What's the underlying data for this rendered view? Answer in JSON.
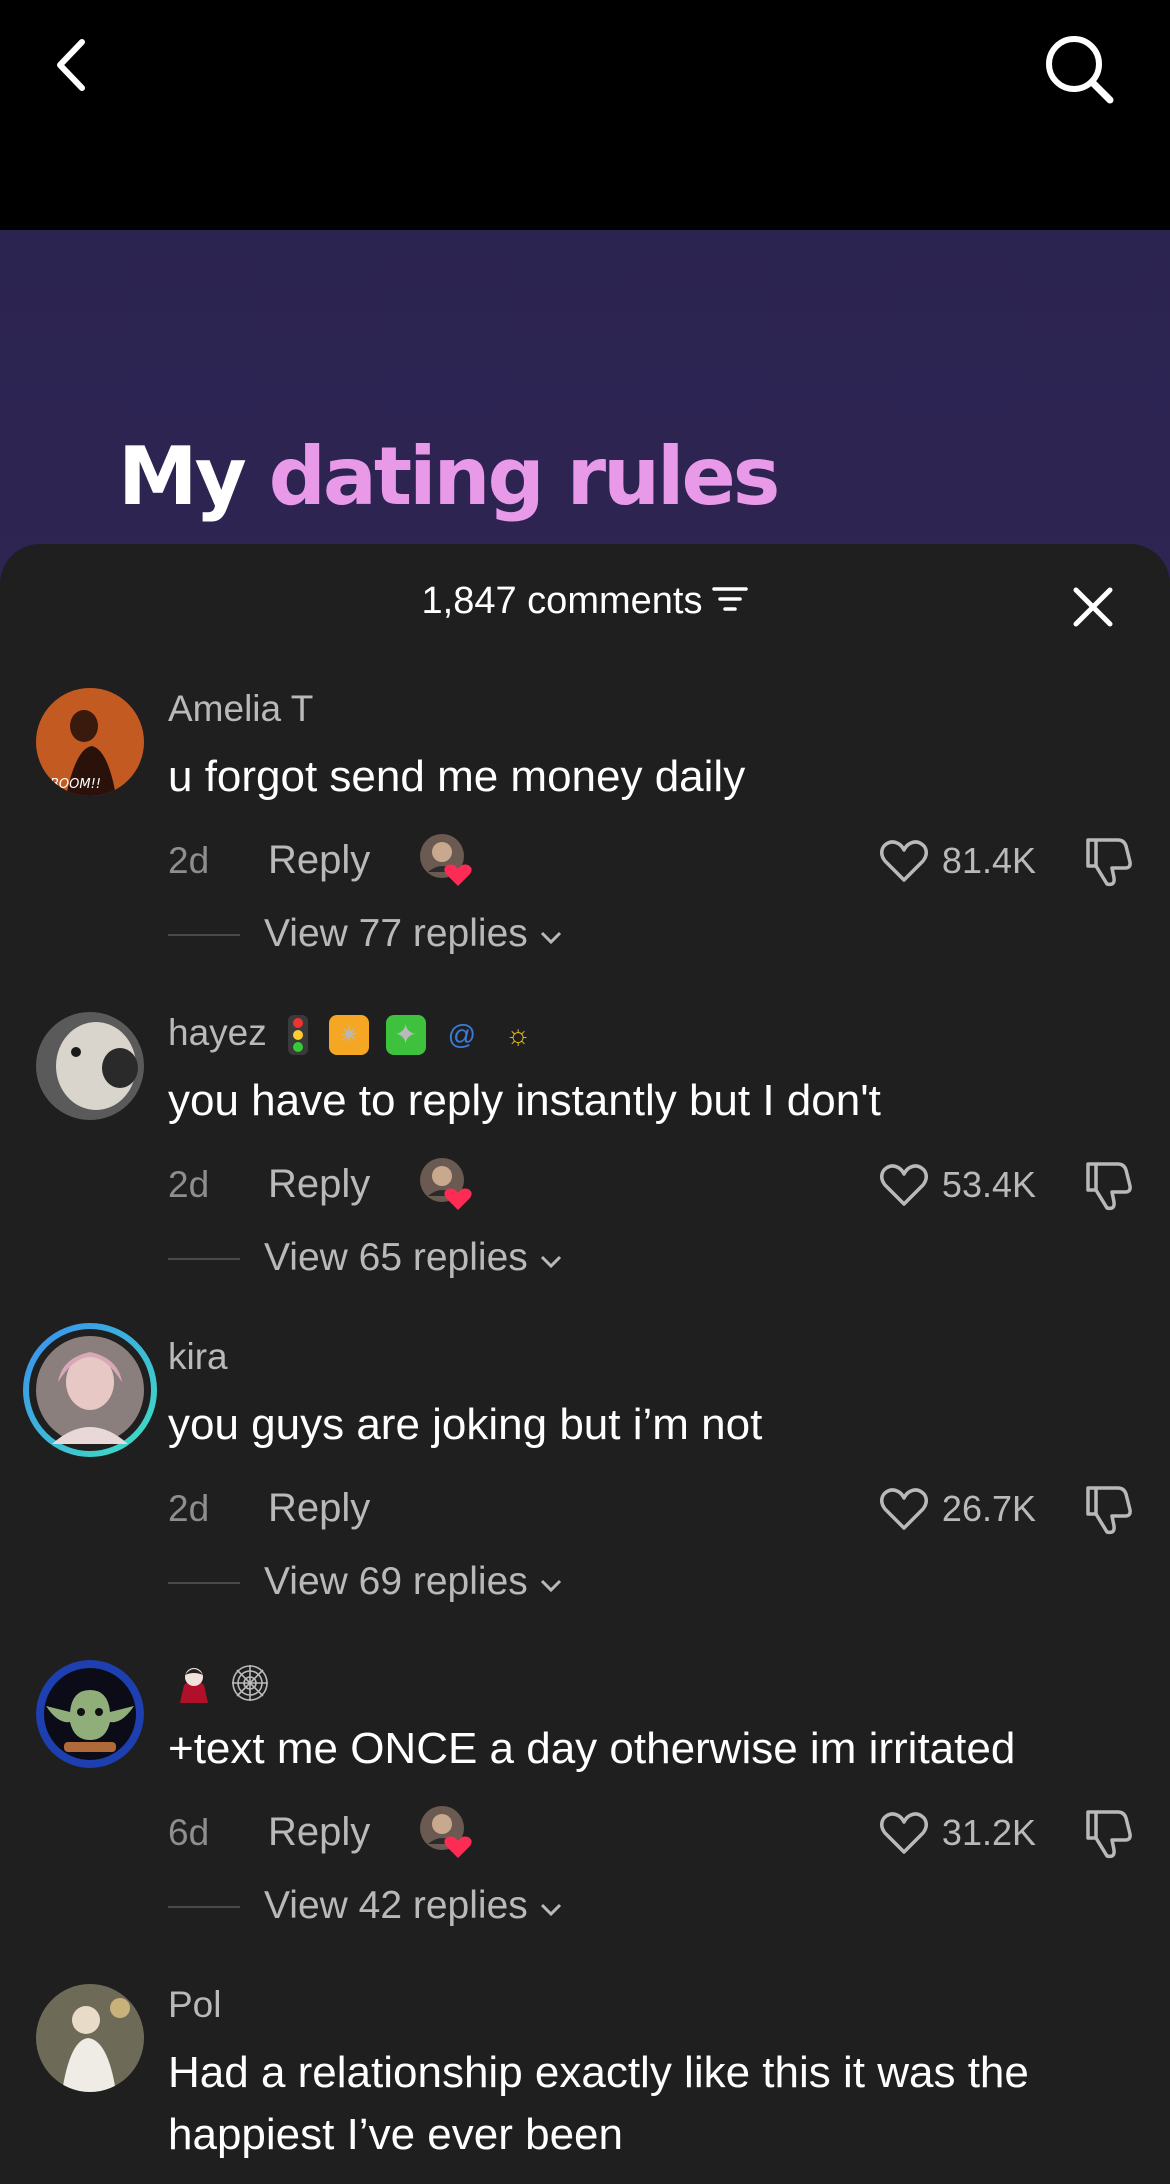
{
  "header": {
    "back_icon": "chevron-left-icon",
    "search_icon": "search-icon"
  },
  "video": {
    "title_word1": "My",
    "title_word2": "dating rules",
    "accent": "#e89ae8"
  },
  "sheet": {
    "comments_count": "1,847 comments",
    "filter_icon": "filter-icon",
    "close_icon": "close-icon"
  },
  "comments": [
    {
      "username": "Amelia T",
      "text": "u forgot send me money daily",
      "date": "2d",
      "reply_label": "Reply",
      "likes": "81.4K",
      "creator_liked": true,
      "view_replies": "View 77 replies"
    },
    {
      "username": "hayez",
      "text": "you have to reply instantly but I don't",
      "date": "2d",
      "reply_label": "Reply",
      "likes": "53.4K",
      "creator_liked": true,
      "view_replies": "View 65 replies"
    },
    {
      "username": "kira",
      "text": "you guys are joking but i’m not",
      "date": "2d",
      "reply_label": "Reply",
      "likes": "26.7K",
      "creator_liked": false,
      "view_replies": "View 69 replies"
    },
    {
      "username": "",
      "text": "+text me ONCE a day otherwise im irritated",
      "date": "6d",
      "reply_label": "Reply",
      "likes": "31.2K",
      "creator_liked": true,
      "view_replies": "View 42 replies"
    },
    {
      "username": "Pol",
      "text": "Had a relationship exactly like this it was the happiest I’ve ever been"
    }
  ]
}
